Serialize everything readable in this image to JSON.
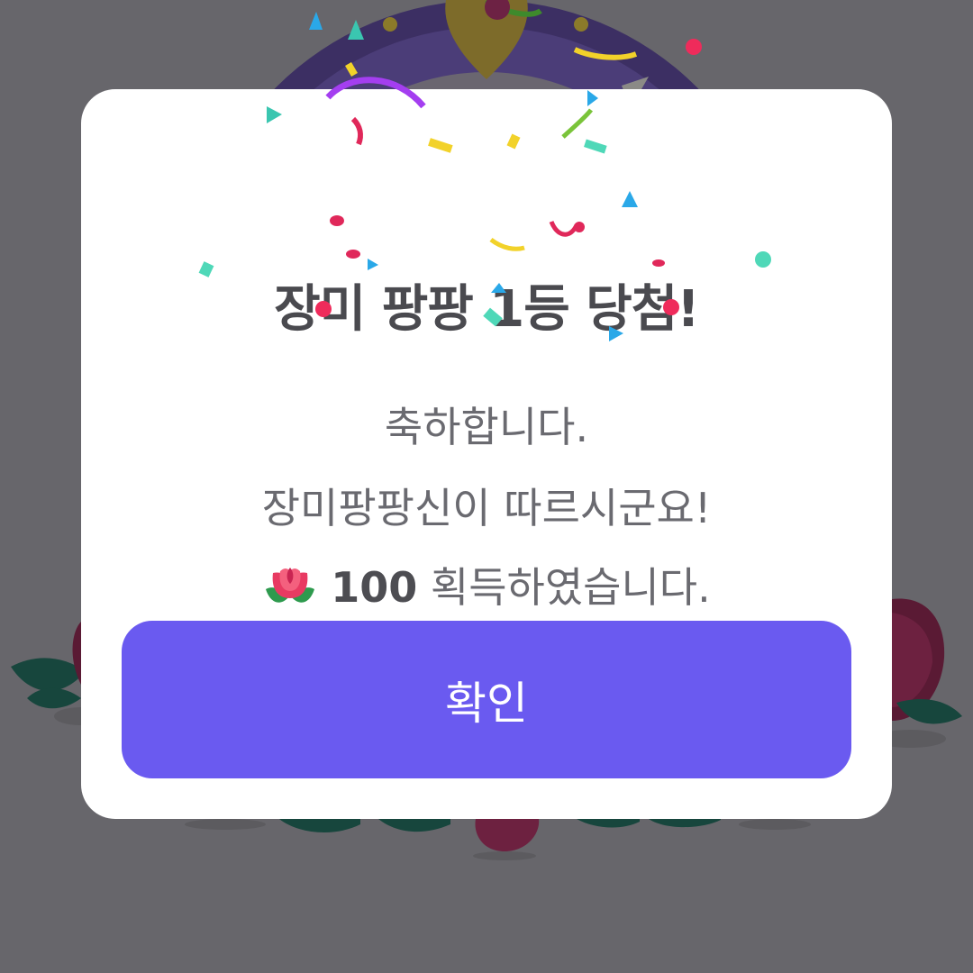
{
  "dialog": {
    "title": "장미 팡팡 1등 당첨!",
    "message_line1": "축하합니다.",
    "message_line2": "장미팡팡신이 따르시군요!",
    "reward_icon": "rose-icon",
    "reward_amount": "100",
    "reward_suffix": " 획득하였습니다.",
    "confirm_label": "확인"
  },
  "colors": {
    "overlay": "#67666b",
    "button": "#6a5af0",
    "title": "#4a4a4f",
    "text": "#6a6a70"
  }
}
